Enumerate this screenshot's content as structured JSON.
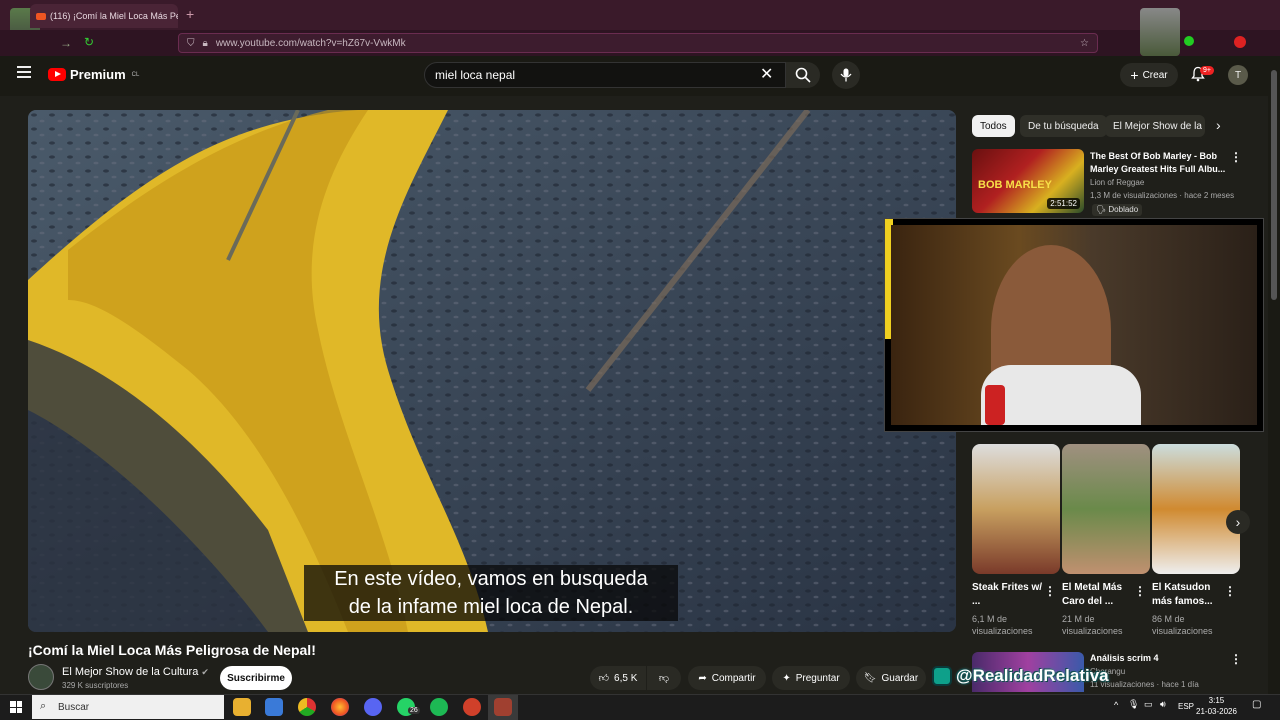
{
  "browser": {
    "tab_title": "(116) ¡Comí la Miel Loca Más Pe",
    "url": "www.youtube.com/watch?v=hZ67v-VwkMk"
  },
  "youtube": {
    "logo": "Premium",
    "country": "CL",
    "search_query": "miel loca nepal",
    "create_label": "Crear",
    "notifications": "9+",
    "avatar_letter": "T"
  },
  "video": {
    "subtitle_line1": "En este vídeo, vamos en busqueda",
    "subtitle_line2": "de la infame miel loca de Nepal.",
    "title": "¡Comí la Miel Loca Más Peligrosa de Nepal!",
    "channel": "El Mejor Show de la Cultura",
    "subscribers": "329 K suscriptores",
    "subscribe_label": "Suscribirme",
    "likes": "6,5 K",
    "share_label": "Compartir",
    "ask_label": "Preguntar",
    "save_label": "Guardar"
  },
  "sidebar": {
    "chips": [
      "Todos",
      "De tu búsqueda",
      "El Mejor Show de la C"
    ],
    "rec1": {
      "title": "The Best Of Bob Marley - Bob Marley Greatest Hits Full Albu...",
      "channel": "Lion of Reggae",
      "meta": "1,3 M de visualizaciones · hace 2 meses",
      "badge": "Doblado",
      "duration": "2:51:52",
      "thumb_text": "BOB MARLEY"
    },
    "shorts": [
      {
        "title": "Steak Frites w/ ...",
        "views": "6,1 M de visualizaciones"
      },
      {
        "title": "El Metal Más Caro del ...",
        "views": "21 M de visualizaciones"
      },
      {
        "title": "El Katsudon más famos...",
        "views": "86 M de visualizaciones"
      }
    ],
    "rec2": {
      "title": "Análisis scrim 4",
      "channel": "Chorangu",
      "meta": "11 visualizaciones · hace 1 día"
    }
  },
  "watermark": "@RealidadRelativa",
  "taskbar": {
    "search_placeholder": "Buscar",
    "whatsapp_badge": "26",
    "language": "ESP",
    "time": "3:15",
    "date": "21-03-2026"
  },
  "colors": {
    "accent": "#ff0000",
    "tab_bg": "#3a1a2a"
  }
}
